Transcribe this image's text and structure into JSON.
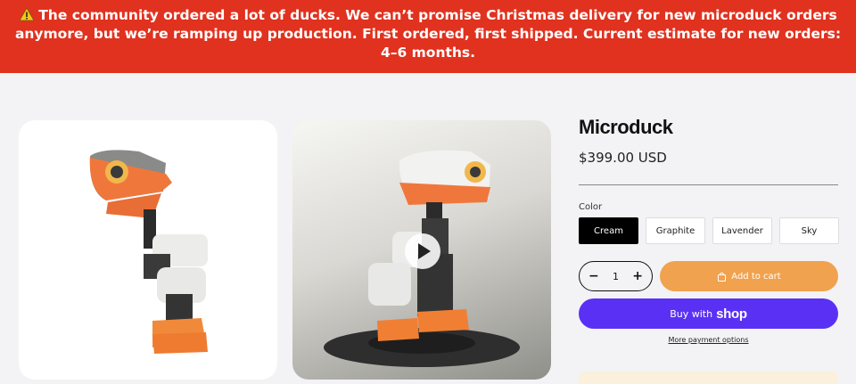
{
  "banner": {
    "icon": "warning-icon",
    "text": "The community ordered a lot of ducks. We can’t promise Christmas delivery for new microduck orders anymore, but we’re ramping up production. First ordered, first shipped. Current estimate for new orders: 4–6 months."
  },
  "gallery": {
    "images": [
      {
        "name": "microduck-product-photo"
      },
      {
        "name": "microduck-video-thumbnail",
        "icon": "play-icon"
      }
    ]
  },
  "product": {
    "title": "Microduck",
    "price": "$399.00 USD",
    "color_label": "Color",
    "colors": [
      "Cream",
      "Graphite",
      "Lavender",
      "Sky"
    ],
    "selected_color": "Cream",
    "quantity": {
      "minus": "−",
      "value": "1",
      "plus": "+"
    },
    "add_to_cart": "Add to cart",
    "buy_with": "Buy with",
    "buy_brand": "shop",
    "more_payment": "More payment options"
  },
  "colors": {
    "banner_bg": "#e0321f",
    "add_to_cart_bg": "#f0a24e",
    "shop_pay_bg": "#5a31f4",
    "page_bg": "#f3f3f5"
  }
}
